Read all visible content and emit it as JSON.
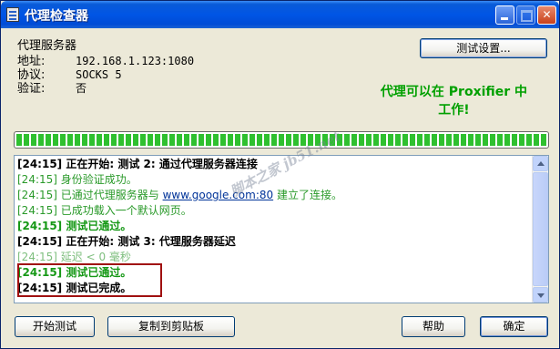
{
  "window": {
    "title": "代理检查器"
  },
  "info": {
    "header": "代理服务器",
    "address_label": "地址:",
    "address_value": "192.168.1.123:1080",
    "protocol_label": "协议:",
    "protocol_value": "SOCKS 5",
    "auth_label": "验证:",
    "auth_value": "否"
  },
  "buttons": {
    "test_settings": "测试设置...",
    "start_test": "开始测试",
    "copy_clipboard": "复制到剪贴板",
    "help": "帮助",
    "ok": "确定"
  },
  "status_message": {
    "line1": "代理可以在 Proxifier 中",
    "line2": "工作!"
  },
  "progress": {
    "percent": 100
  },
  "log": [
    {
      "text": "[24:15] 正在开始: 测试 2: 通过代理服务器连接",
      "style": "bold"
    },
    {
      "text": "[24:15] 身份验证成功。",
      "style": "green"
    },
    {
      "prefix": "[24:15] 已通过代理服务器与 ",
      "link": "www.google.com:80",
      "suffix": " 建立了连接。",
      "style": "green"
    },
    {
      "text": "[24:15] 已成功载入一个默认网页。",
      "style": "green"
    },
    {
      "text": "[24:15] 测试已通过。",
      "style": "greenbold"
    },
    {
      "text": "[24:15] 正在开始: 测试 3: 代理服务器延迟",
      "style": "bold"
    },
    {
      "text": "[24:15] 延迟 < 0 毫秒",
      "style": "gray"
    },
    {
      "text": "[24:15] 测试已通过。",
      "style": "greenbold"
    },
    {
      "text": "[24:15] 测试已完成。",
      "style": "bold"
    }
  ],
  "watermark": "脚本之家 jb51.net",
  "colors": {
    "titlebar": "#0055E5",
    "status_green": "#00A000",
    "highlight_border": "#A01010"
  }
}
